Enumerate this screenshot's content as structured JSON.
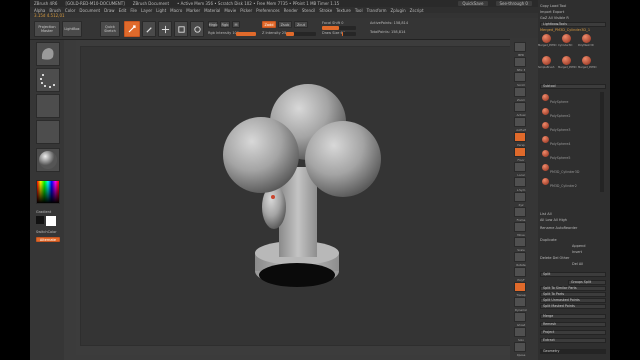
{
  "window": {
    "title_app": "ZBrush 4R6",
    "title_project": "[GOLD-RED-M10-DOCUMENT]",
    "title_doc": "ZBrush Document",
    "title_stats": "• Active Mem 356 • Scratch Disk 102 • Free Mem 7735 • PPoint 1 MB Timer 1.15",
    "quicksave_label": "QuickSave",
    "seethrough_label": "See-through 0",
    "menus_label": "Menus",
    "default_zscript_label": "DefaultZScript"
  },
  "menubar": {
    "items": [
      "Alpha",
      "Brush",
      "Color",
      "Document",
      "Draw",
      "Edit",
      "File",
      "Layer",
      "Light",
      "Macro",
      "Marker",
      "Material",
      "Movie",
      "Picker",
      "Preferences",
      "Render",
      "Stencil",
      "Stroke",
      "Texture",
      "Tool",
      "Transform",
      "Zplugin",
      "Zscript"
    ]
  },
  "status": {
    "text": "3.15d 4.512,01"
  },
  "topshelf": {
    "projection_label": "Projection Master",
    "lightbox_label": "LightBox",
    "quick_sketch_label": "Quick Sketch",
    "edit_label": "Edit",
    "draw_label": "Draw",
    "move_label": "Move",
    "scale_label": "Scale",
    "rotate_label": "Rotate",
    "mrgb_label": "Mrgb",
    "rgb_label": "Rgb",
    "m_label": "M",
    "zadd_label": "Zadd",
    "zsub_label": "Zsub",
    "zcut_label": "Zcut",
    "focal_shift_label": "Focal Shift 0",
    "draw_size_label": "Draw Size 64",
    "rgb_intensity_label": "Rgb Intensity 100",
    "z_intensity_label": "Z Intensity 25",
    "active_points_label": "ActivePoints: 158,814",
    "total_points_label": "TotalPoints: 158,814",
    "z_intensity_value": 25,
    "focal_shift_value": 0,
    "rgb_intensity_value": 100,
    "draw_size_value": 64
  },
  "leftshelf": {
    "gradient_label": "Gradient",
    "switch_color_label": "SwitchColor",
    "alternate_label": "Alternate"
  },
  "rightshelf": {
    "items": [
      "BPR",
      "SPix 3",
      "Scroll",
      "Zoom",
      "Actual",
      "AAHalf",
      "Persp",
      "Floor",
      "Local",
      "L.Sym",
      "Xyz",
      "Frame",
      "Move",
      "Scale",
      "Rotate",
      "PolyF",
      "Transp",
      "Dynamic",
      "Ghost",
      "Solo",
      "Xpose"
    ]
  },
  "tray": {
    "header_copy_label": "Copy",
    "header_load_tool_label": "Load Tool",
    "header_import_label": "Import",
    "header_export_label": "Export",
    "goz_label": "GoZ",
    "all_label": "All",
    "visible_label": "Visible",
    "r_label": "R",
    "lightbox_tools_label": "Lightbox▸Tools",
    "tool_name": "Merged_PM3D_Cylinder3D_1",
    "thumbs": [
      "Merged_PM3D",
      "Cylinder3D",
      "PolyMesh3D",
      "SimpleBrush",
      "Merged_PM3D",
      "Merged_PM3D"
    ],
    "subtool_label": "Subtool",
    "subtools": [
      "PolySphere",
      "PolySphere2",
      "PolySphere3",
      "PolySphere4",
      "PolySphere5",
      "PM3D_Cylinder3D",
      "PM3D_Cylinder2"
    ],
    "list_all_label": "List All",
    "all_low_label": "All Low",
    "all_high_label": "All High",
    "rename_label": "Rename",
    "auto_reorder_label": "AutoReorder",
    "duplicate_label": "Duplicate",
    "append_label": "Append",
    "insert_label": "Insert",
    "del_other_label": "Del Other",
    "delete_label": "Delete",
    "del_all_label": "Del All",
    "split_label": "Split",
    "groups_split_label": "Groups Split",
    "split_to_similar_label": "Split To Similar Parts",
    "split_to_parts_label": "Split To Parts",
    "split_unmasked_label": "Split Unmasked Points",
    "split_masked_label": "Split Masked Points",
    "merge_label": "Merge",
    "remesh_label": "Remesh",
    "project_label": "Project",
    "extract_label": "Extract",
    "geometry_label": "Geometry"
  },
  "colors": {
    "accent": "#e06a2b",
    "panel": "#363636",
    "canvas": "#343434",
    "model": "#a9a9a9"
  }
}
